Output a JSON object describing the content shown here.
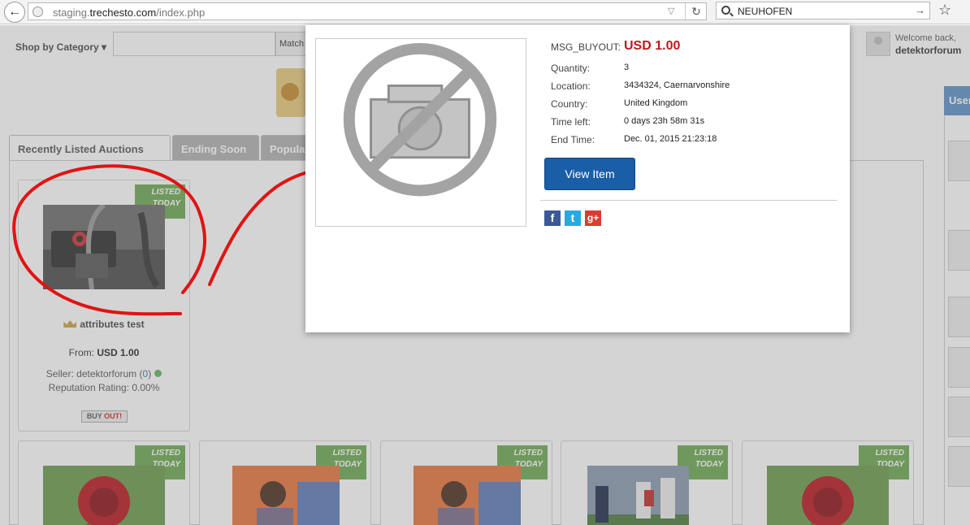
{
  "browser": {
    "url_prefix": "staging.",
    "url_host": "trechesto.com",
    "url_path": "/index.php",
    "search_value": "NEUHOFEN"
  },
  "header": {
    "shop_by_category": "Shop by Category",
    "match_label": "Match",
    "welcome_text": "Welcome back,",
    "username": "detektorforum",
    "side_tab_label": "User"
  },
  "tabs": [
    {
      "label": "Recently Listed Auctions"
    },
    {
      "label": "Ending Soon"
    },
    {
      "label": "Popular"
    }
  ],
  "ribbon": {
    "line1": "LISTED",
    "line2": "TODAY"
  },
  "featured_card": {
    "title": "attributes test",
    "price_prefix": "From:",
    "price": "USD 1.00",
    "seller_prefix": "Seller:",
    "seller": "detektorforum",
    "seller_rating_count": "0",
    "reputation": "Reputation Rating: 0.00%",
    "buyout_a": "BUY",
    "buyout_b": "OUT!"
  },
  "modal": {
    "price_label": "MSG_BUYOUT:",
    "price_value": "USD 1.00",
    "rows": [
      {
        "label": "Quantity:",
        "value": "3"
      },
      {
        "label": "Location:",
        "value": "3434324, Caernarvonshire"
      },
      {
        "label": "Country:",
        "value": "United Kingdom"
      },
      {
        "label": "Time left:",
        "value": "0 days 23h 58m 31s"
      },
      {
        "label": "End Time:",
        "value": "Dec. 01, 2015 21:23:18"
      }
    ],
    "view_button": "View Item",
    "social": {
      "facebook": "f",
      "twitter": "t",
      "google": "g+"
    }
  },
  "colors": {
    "accent": "#1a5ea8",
    "price": "#c0181a",
    "ribbon": "#6aa84f",
    "annotation": "#e01414"
  }
}
